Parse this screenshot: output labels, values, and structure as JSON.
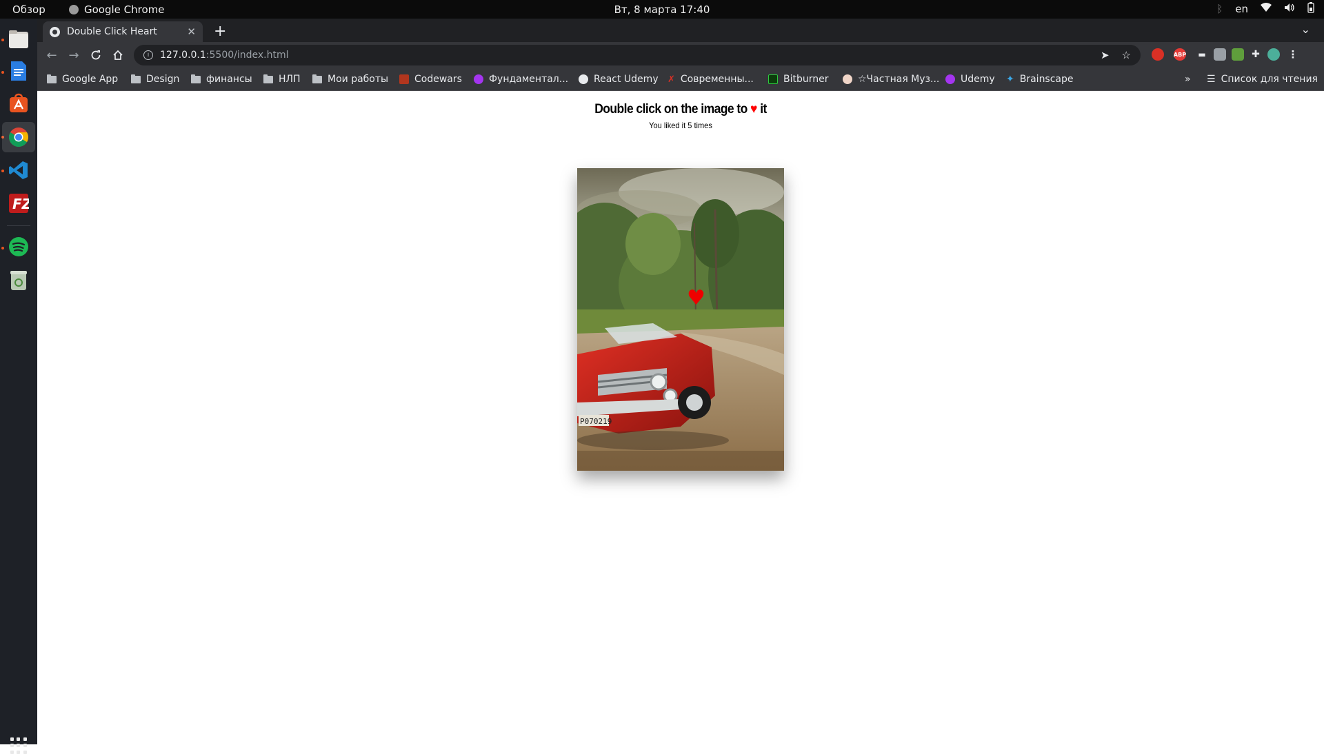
{
  "system": {
    "activities": "Обзор",
    "app_name": "Google Chrome",
    "clock": "Вт, 8 марта  17:40",
    "lang": "en"
  },
  "dock": {
    "items": [
      "files-icon",
      "writer-icon",
      "software-icon",
      "chrome-icon",
      "vscode-icon",
      "filezilla-icon",
      "spotify-icon",
      "trash-icon"
    ]
  },
  "browser": {
    "tab_title": "Double Click Heart",
    "url_host": "127.0.0.1",
    "url_path": ":5500/index.html",
    "bookmarks": [
      {
        "label": "Google App",
        "icon": "folder"
      },
      {
        "label": "Design",
        "icon": "folder"
      },
      {
        "label": "финансы",
        "icon": "folder"
      },
      {
        "label": "НЛП",
        "icon": "folder"
      },
      {
        "label": "Мои работы",
        "icon": "folder"
      },
      {
        "label": "Codewars",
        "icon": "codewars"
      },
      {
        "label": "Фундаментал...",
        "icon": "udemy"
      },
      {
        "label": "React Udemy",
        "icon": "globe"
      },
      {
        "label": "Современны...",
        "icon": "x"
      },
      {
        "label": "Bitburner",
        "icon": "bitburner"
      },
      {
        "label": "☆Частная Муз...",
        "icon": "avatar"
      },
      {
        "label": "Udemy",
        "icon": "udemy"
      },
      {
        "label": "Brainscape",
        "icon": "brainscape"
      }
    ],
    "more": "»",
    "reading_list": "Список для чтения"
  },
  "page": {
    "title_before": "Double click on the image to",
    "title_heart": "♥",
    "title_after": "it",
    "counter_prefix": "You liked it",
    "counter_value": "5",
    "counter_suffix": "times"
  },
  "colors": {
    "heart": "#e00000",
    "tab_active": "#35363a",
    "tabstrip": "#202124",
    "dock": "#1e2127"
  }
}
